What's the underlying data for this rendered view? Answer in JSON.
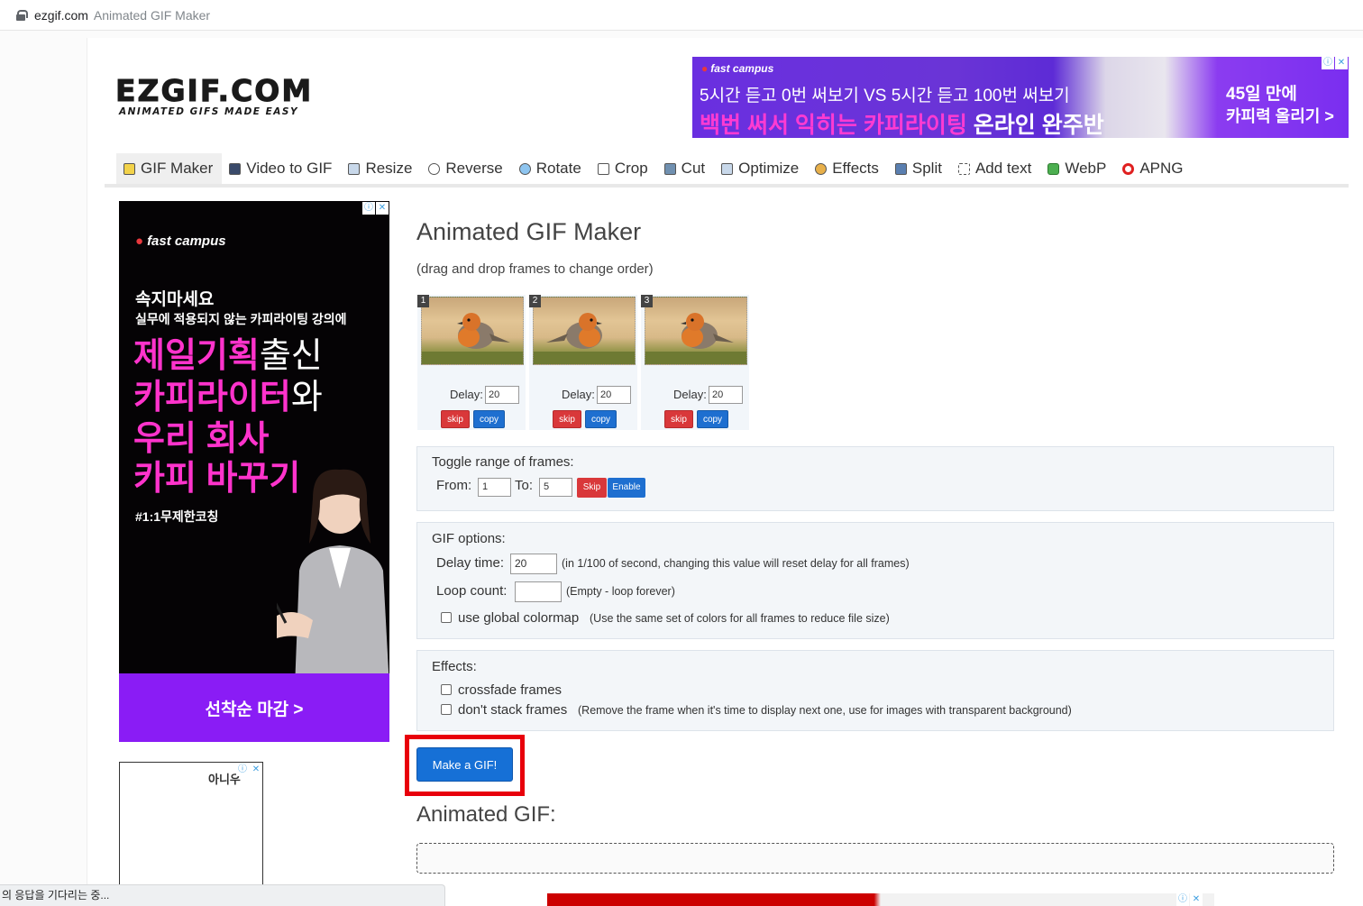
{
  "browser": {
    "domain": "ezgif.com",
    "page_title": "Animated GIF Maker"
  },
  "logo": {
    "main": "EZGIF.COM",
    "tagline": "ANIMATED GIFS MADE EASY"
  },
  "banner_ad": {
    "brand": "fast campus",
    "line1": "5시간 듣고 0번 써보기 VS 5시간 듣고 100번 써보기",
    "line2_highlight": "백번 써서 익히는 카피라이팅",
    "line2_rest": " 온라인 완주반",
    "right1": "45일 만에",
    "right2": "카피력 올리기 >"
  },
  "nav": {
    "items": [
      {
        "label": "GIF Maker",
        "icon": "gif-maker-icon",
        "active": true
      },
      {
        "label": "Video to GIF",
        "icon": "film-icon"
      },
      {
        "label": "Resize",
        "icon": "resize-icon"
      },
      {
        "label": "Reverse",
        "icon": "reverse-icon"
      },
      {
        "label": "Rotate",
        "icon": "rotate-icon"
      },
      {
        "label": "Crop",
        "icon": "crop-icon"
      },
      {
        "label": "Cut",
        "icon": "cut-icon"
      },
      {
        "label": "Optimize",
        "icon": "optimize-icon"
      },
      {
        "label": "Effects",
        "icon": "effects-icon"
      },
      {
        "label": "Split",
        "icon": "split-icon"
      },
      {
        "label": "Add text",
        "icon": "add-text-icon"
      },
      {
        "label": "WebP",
        "icon": "webp-icon"
      },
      {
        "label": "APNG",
        "icon": "apng-icon"
      }
    ]
  },
  "side_ad": {
    "brand": "fast campus",
    "t1": "속지마세요",
    "t2": "실무에 적용되지 않는 카피라이팅 강의에",
    "big1_pink": "제일기획",
    "big1_white": "출신",
    "big2_pink": "카피라이터",
    "big2_white": "와",
    "big3": "우리 회사",
    "big4": "카피 바꾸기",
    "sub": "#1:1무제한코칭",
    "cta": "선착순 마감 >"
  },
  "side_ad2": {
    "logo": "아니우"
  },
  "main": {
    "title": "Animated GIF Maker",
    "hint": "(drag and drop frames to change order)",
    "frames": [
      {
        "num": "1",
        "delay_label": "Delay:",
        "delay": "20",
        "skip": "skip",
        "copy": "copy"
      },
      {
        "num": "2",
        "delay_label": "Delay:",
        "delay": "20",
        "skip": "skip",
        "copy": "copy"
      },
      {
        "num": "3",
        "delay_label": "Delay:",
        "delay": "20",
        "skip": "skip",
        "copy": "copy"
      }
    ],
    "toggle": {
      "title": "Toggle range of frames:",
      "from_label": "From:",
      "from_value": "1",
      "to_label": "To:",
      "to_value": "5",
      "skip": "Skip",
      "enable": "Enable"
    },
    "options": {
      "title": "GIF options:",
      "delay_label": "Delay time:",
      "delay_value": "20",
      "delay_note": "(in 1/100 of second, changing this value will reset delay for all frames)",
      "loop_label": "Loop count:",
      "loop_value": "",
      "loop_note": "(Empty - loop forever)",
      "colormap_label": "use global colormap",
      "colormap_note": "(Use the same set of colors for all frames to reduce file size)"
    },
    "effects": {
      "title": "Effects:",
      "crossfade": "crossfade frames",
      "nostack": "don't stack frames",
      "nostack_note": "(Remove the frame when it's time to display next one, use for images with transparent background)"
    },
    "make_button": "Make a GIF!",
    "result_title": "Animated GIF:"
  },
  "status_bar": "의 응답을 기다리는 중..."
}
